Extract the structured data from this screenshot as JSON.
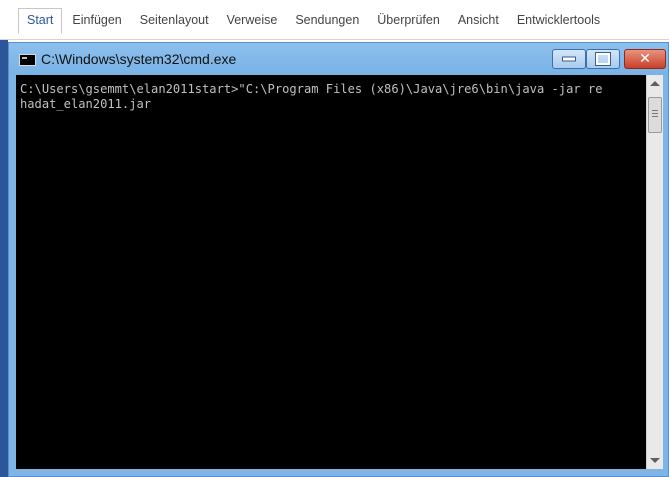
{
  "ribbon": {
    "tabs": [
      "Start",
      "Einfügen",
      "Seitenlayout",
      "Verweise",
      "Sendungen",
      "Überprüfen",
      "Ansicht",
      "Entwicklertools"
    ],
    "active_tab": "Start",
    "accent_color": "#2b579a"
  },
  "window": {
    "title": "C:\\Windows\\system32\\cmd.exe",
    "icon": "console-icon",
    "controls": [
      "minimize-icon",
      "maximize-icon",
      "close-icon"
    ]
  },
  "console": {
    "lines": [
      "C:\\Users\\gsemmt\\elan2011start>\"C:\\Program Files (x86)\\Java\\jre6\\bin\\java -jar re",
      "hadat_elan2011.jar"
    ],
    "background": "#000000",
    "foreground": "#c0c0c0"
  }
}
